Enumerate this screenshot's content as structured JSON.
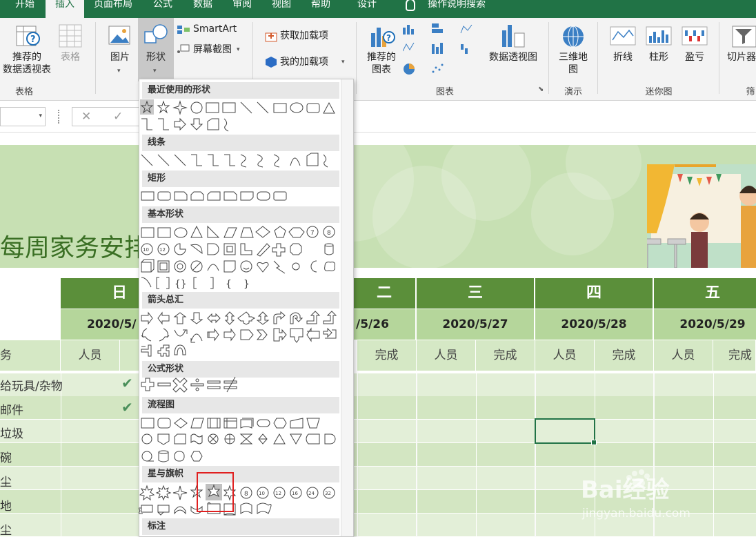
{
  "ribbon_tabs": [
    "开始",
    "插入",
    "页面布局",
    "公式",
    "数据",
    "审阅",
    "视图",
    "帮助",
    "设计",
    "操作说明搜索"
  ],
  "ribbon": {
    "recommended_pivot": "推荐的\n数据透视表",
    "table": "表格",
    "group_tables": "表格",
    "pictures": "图片",
    "shapes": "形状",
    "smartart": "SmartArt",
    "screenshot": "屏幕截图",
    "get_addins": "获取加载项",
    "my_addins": "我的加载项",
    "recommended_charts": "推荐的\n图表",
    "pivot_chart": "数据透视图",
    "group_charts": "图表",
    "map3d": "三维地\n图",
    "group_tours": "演示",
    "line": "折线",
    "column": "柱形",
    "winloss": "盈亏",
    "group_sparklines": "迷你图",
    "slicer": "切片器",
    "group_filters": "筛"
  },
  "formula_bar": {
    "cancel": "✕",
    "enter": "✓"
  },
  "dropdown": {
    "sections": [
      "最近使用的形状",
      "线条",
      "矩形",
      "基本形状",
      "箭头总汇",
      "公式形状",
      "流程图",
      "星与旗帜",
      "标注"
    ]
  },
  "sheet": {
    "title": "每周家务安排",
    "days": [
      "日",
      "二",
      "三",
      "四",
      "五"
    ],
    "dates": [
      "2020/5/",
      "/5/26",
      "2020/5/27",
      "2020/5/28",
      "2020/5/29"
    ],
    "person_label": "人员",
    "done_label": "完成",
    "task_header": "务",
    "tasks": [
      "给玩具/杂物",
      "邮件",
      "垃圾",
      "碗",
      "尘",
      "地",
      "尘"
    ],
    "checks": [
      "✔",
      "✔"
    ]
  },
  "watermark": {
    "logo": "Bai经验",
    "domain": "jingyan.baidu.com"
  },
  "colors": {
    "excel_green": "#217346",
    "header_green": "#5b8f3a",
    "date_green": "#b5d69b",
    "banner_green": "#c7e0b3",
    "highlight_red": "#e02020"
  }
}
